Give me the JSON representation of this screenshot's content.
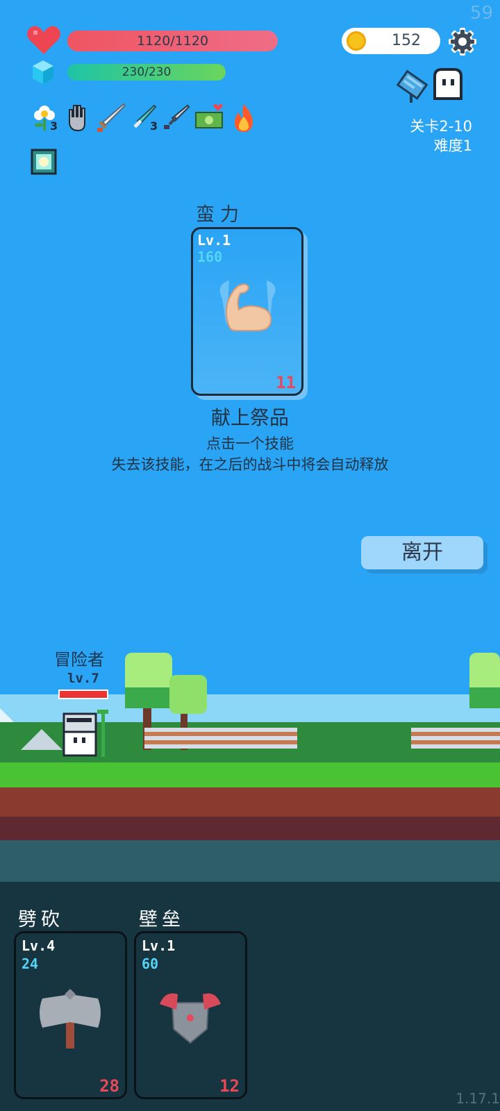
{
  "hud": {
    "fps": "59",
    "hp": "1120/1120",
    "mp": "230/230",
    "coins": "152",
    "stage": "关卡2-10",
    "difficulty": "难度1",
    "buff_counts": [
      "3",
      "3"
    ]
  },
  "sacrifice": {
    "skill_name": "蛮力",
    "level": "Lv.1",
    "cost": "160",
    "value": "11",
    "title": "献上祭品",
    "line1": "点击一个技能",
    "line2": "失去该技能，在之后的战斗中将会自动释放",
    "leave_label": "离开"
  },
  "player": {
    "name": "冒险者",
    "level": "lv.7",
    "hp_fraction": 1.0
  },
  "skills": [
    {
      "name": "劈砍",
      "level": "Lv.4",
      "cost": "24",
      "value": "28",
      "icon": "axe-icon"
    },
    {
      "name": "壁垒",
      "level": "Lv.1",
      "cost": "60",
      "value": "12",
      "icon": "armor-icon"
    }
  ],
  "version": "1.17.1",
  "colors": {
    "sky": "#2aa4f5",
    "hp": "#ef5561",
    "mp": "#6bd55b",
    "accent_red": "#e84858"
  }
}
